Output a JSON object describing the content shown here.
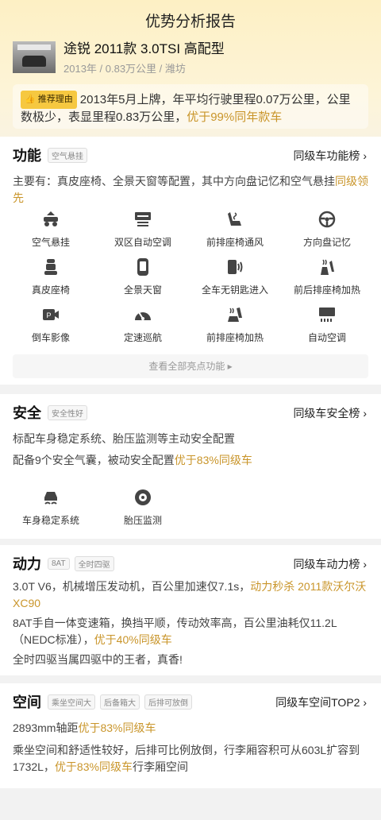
{
  "header": {
    "title": "优势分析报告"
  },
  "car": {
    "name": "途锐 2011款 3.0TSI 高配型",
    "meta": "2013年 / 0.83万公里 / 潍坊"
  },
  "reason": {
    "tag": "推荐理由",
    "text": "2013年5月上牌，年平均行驶里程0.07万公里，公里数极少，表显里程0.83万公里，",
    "highlight": "优于99%同年款车"
  },
  "function": {
    "title": "功能",
    "tag": "空气悬挂",
    "rank_link": "同级车功能榜 ›",
    "summary": "主要有：真皮座椅、全景天窗等配置，其中方向盘记忆和空气悬挂",
    "summary_highlight": "同级领先",
    "features": [
      {
        "label": "空气悬挂",
        "icon": "air-suspension-icon"
      },
      {
        "label": "双区自动空调",
        "icon": "dual-zone-ac-icon"
      },
      {
        "label": "前排座椅通风",
        "icon": "seat-ventilation-icon"
      },
      {
        "label": "方向盘记忆",
        "icon": "steering-wheel-icon"
      },
      {
        "label": "真皮座椅",
        "icon": "leather-seat-icon"
      },
      {
        "label": "全景天窗",
        "icon": "panoramic-sunroof-icon"
      },
      {
        "label": "全车无钥匙进入",
        "icon": "keyless-entry-icon"
      },
      {
        "label": "前后排座椅加热",
        "icon": "rear-seat-heating-icon"
      },
      {
        "label": "倒车影像",
        "icon": "reverse-camera-icon"
      },
      {
        "label": "定速巡航",
        "icon": "cruise-control-icon"
      },
      {
        "label": "前排座椅加热",
        "icon": "front-seat-heating-icon"
      },
      {
        "label": "自动空调",
        "icon": "auto-ac-icon"
      }
    ],
    "more_label": "查看全部亮点功能 ▸"
  },
  "safety": {
    "title": "安全",
    "tag": "安全性好",
    "rank_link": "同级车安全榜 ›",
    "line1": "标配车身稳定系统、胎压监测等主动安全配置",
    "line2": "配备9个安全气囊，被动安全配置",
    "line2_highlight": "优于83%同级车",
    "features": [
      {
        "label": "车身稳定系统",
        "icon": "stability-control-icon"
      },
      {
        "label": "胎压监测",
        "icon": "tire-pressure-icon"
      }
    ]
  },
  "power": {
    "title": "动力",
    "tags": [
      "8AT",
      "全时四驱"
    ],
    "rank_link": "同级车动力榜 ›",
    "p1": "3.0T V6，机械增压发动机，百公里加速仅7.1s，",
    "p1_highlight": "动力秒杀 2011款沃尔沃XC90",
    "p2": "8AT手自一体变速箱，换挡平顺，传动效率高，百公里油耗仅11.2L（NEDC标准），",
    "p2_highlight": "优于40%同级车",
    "p3": "全时四驱当属四驱中的王者，真香!"
  },
  "space": {
    "title": "空间",
    "tags": [
      "乘坐空间大",
      "后备箱大",
      "后排可放倒"
    ],
    "rank_link": "同级车空间TOP2 ›",
    "p1": "2893mm轴距",
    "p1_highlight": "优于83%同级车",
    "p2": "乘坐空间和舒适性较好，后排可比例放倒，行李厢容积可从603L扩容到1732L，",
    "p2_highlight": "优于83%同级车",
    "p2_tail": "行李厢空间"
  }
}
